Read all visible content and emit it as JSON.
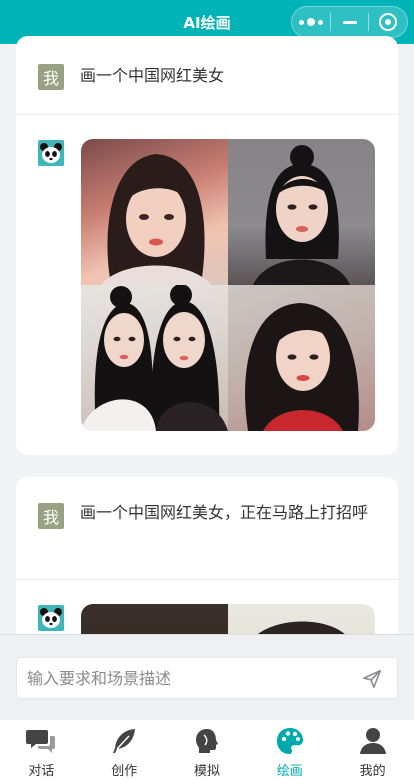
{
  "header": {
    "title": "AI绘画"
  },
  "conversation": [
    {
      "user_avatar_label": "我",
      "prompt": "画一个中国网红美女",
      "result_images": [
        "portrait-wavy-hair",
        "portrait-ponytail",
        "portrait-twins",
        "portrait-red-top"
      ]
    },
    {
      "user_avatar_label": "我",
      "prompt": "画一个中国网红美女，正在马路上打招呼",
      "result_images": [
        "portrait-street-1",
        "portrait-street-2"
      ]
    }
  ],
  "input": {
    "placeholder": "输入要求和场景描述"
  },
  "tabs": [
    {
      "label": "对话",
      "icon": "chat-bubbles-icon",
      "active": false
    },
    {
      "label": "创作",
      "icon": "feather-icon",
      "active": false
    },
    {
      "label": "模拟",
      "icon": "head-silhouette-icon",
      "active": false
    },
    {
      "label": "绘画",
      "icon": "palette-icon",
      "active": true
    },
    {
      "label": "我的",
      "icon": "user-icon",
      "active": false
    }
  ],
  "colors": {
    "brand": "#00b3b6",
    "active_tab": "#00a9ad"
  }
}
